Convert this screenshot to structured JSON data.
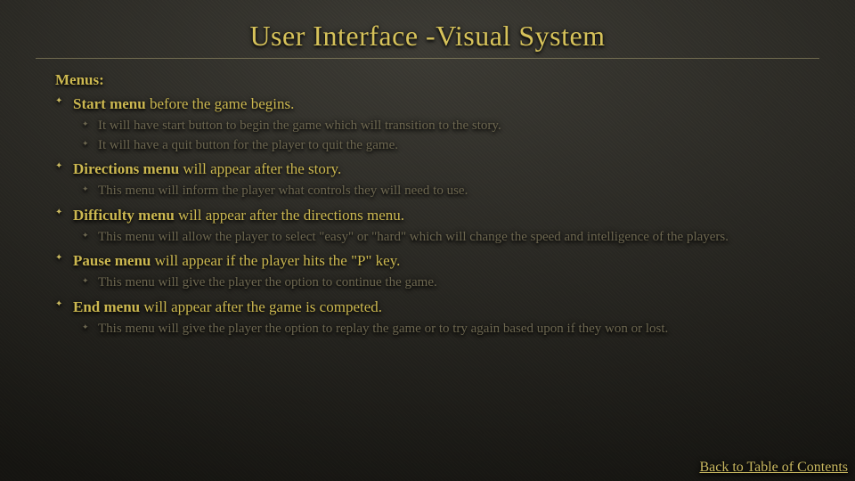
{
  "title": "User Interface -Visual System",
  "section_label": "Menus:",
  "items": [
    {
      "bold": "Start menu",
      "rest": " before the game begins.",
      "sub": [
        "It will have start button to begin the game which will transition to the story.",
        "It will have a quit button for the player to quit the game."
      ]
    },
    {
      "bold": "Directions menu",
      "rest": " will appear after the story.",
      "sub": [
        "This menu will inform the player what controls they will need to use."
      ]
    },
    {
      "bold": "Difficulty menu",
      "rest": " will appear after the directions menu.",
      "sub": [
        "This menu will allow the player to select \"easy\" or \"hard\" which will change the speed and intelligence of the players."
      ]
    },
    {
      "bold": "Pause menu",
      "rest": " will appear if the player hits the \"P\" key.",
      "sub": [
        "This menu will give the player the option to continue the game."
      ]
    },
    {
      "bold": "End menu",
      "rest": " will appear after the game is competed.",
      "sub": [
        "This menu will give the player the option to replay the game or to try again based upon if they won or lost."
      ]
    }
  ],
  "back_link": "Back to Table of Contents"
}
